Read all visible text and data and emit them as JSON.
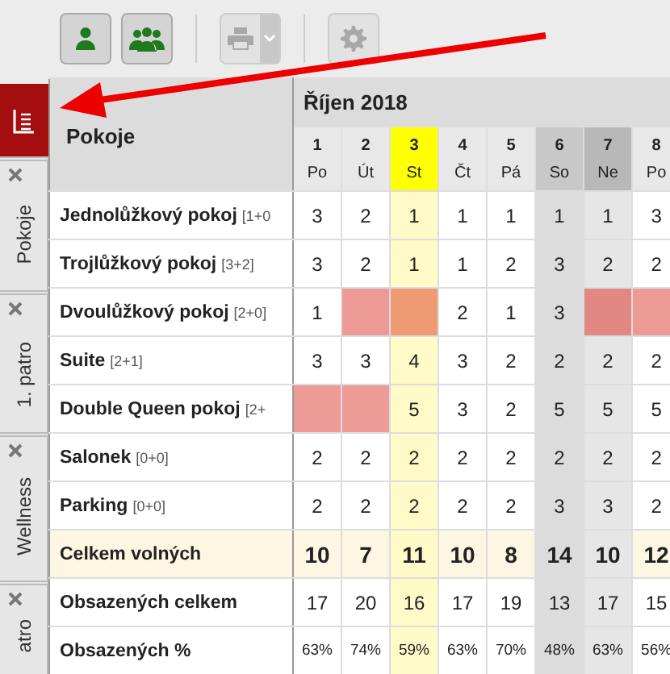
{
  "toolbar": {
    "buttons": [
      {
        "kind": "person",
        "disabled": false
      },
      {
        "kind": "group",
        "disabled": false
      },
      {
        "kind": "print",
        "disabled": true
      },
      {
        "kind": "settings",
        "disabled": true
      }
    ]
  },
  "sidebar": {
    "icon_tab": {
      "selected": true
    },
    "tabs": [
      {
        "label": "Pokoje",
        "closable": true
      },
      {
        "label": "1. patro",
        "closable": true
      },
      {
        "label": "Wellness",
        "closable": true
      },
      {
        "label": "atro",
        "closable": true
      }
    ]
  },
  "table": {
    "corner": "Pokoje",
    "month": "Říjen 2018",
    "days": [
      {
        "num": "1",
        "dow": "Po",
        "kind": "weekday"
      },
      {
        "num": "2",
        "dow": "Út",
        "kind": "weekday"
      },
      {
        "num": "3",
        "dow": "St",
        "kind": "today"
      },
      {
        "num": "4",
        "dow": "Čt",
        "kind": "weekday"
      },
      {
        "num": "5",
        "dow": "Pá",
        "kind": "weekday"
      },
      {
        "num": "6",
        "dow": "So",
        "kind": "saturday"
      },
      {
        "num": "7",
        "dow": "Ne",
        "kind": "sunday"
      },
      {
        "num": "8",
        "dow": "Po",
        "kind": "weekday"
      }
    ],
    "rows": [
      {
        "kind": "room",
        "name": "Jednolůžkový pokoj",
        "capacity": "[1+0",
        "cells": [
          {
            "text": "3",
            "occupied": false
          },
          {
            "text": "2",
            "occupied": false
          },
          {
            "text": "1",
            "occupied": false
          },
          {
            "text": "1",
            "occupied": false
          },
          {
            "text": "1",
            "occupied": false
          },
          {
            "text": "1",
            "occupied": false
          },
          {
            "text": "1",
            "occupied": false
          },
          {
            "text": "3",
            "occupied": false
          }
        ]
      },
      {
        "kind": "room",
        "name": "Trojlůžkový pokoj",
        "capacity": "[3+2]",
        "cells": [
          {
            "text": "3",
            "occupied": false
          },
          {
            "text": "2",
            "occupied": false
          },
          {
            "text": "1",
            "occupied": false
          },
          {
            "text": "1",
            "occupied": false
          },
          {
            "text": "2",
            "occupied": false
          },
          {
            "text": "3",
            "occupied": false
          },
          {
            "text": "2",
            "occupied": false
          },
          {
            "text": "2",
            "occupied": false
          }
        ]
      },
      {
        "kind": "room",
        "name": "Dvoulůžkový pokoj",
        "capacity": "[2+0]",
        "cells": [
          {
            "text": "1",
            "occupied": false
          },
          {
            "occupied": true
          },
          {
            "occupied": true
          },
          {
            "text": "2",
            "occupied": false
          },
          {
            "text": "1",
            "occupied": false
          },
          {
            "text": "3",
            "occupied": false
          },
          {
            "occupied": true
          },
          {
            "occupied": true
          }
        ]
      },
      {
        "kind": "room",
        "name": "Suite",
        "capacity": "[2+1]",
        "cells": [
          {
            "text": "3",
            "occupied": false
          },
          {
            "text": "3",
            "occupied": false
          },
          {
            "text": "4",
            "occupied": false
          },
          {
            "text": "3",
            "occupied": false
          },
          {
            "text": "2",
            "occupied": false
          },
          {
            "text": "2",
            "occupied": false
          },
          {
            "text": "2",
            "occupied": false
          },
          {
            "text": "2",
            "occupied": false
          }
        ]
      },
      {
        "kind": "room",
        "name": "Double Queen pokoj",
        "capacity": "[2+",
        "cells": [
          {
            "occupied": true
          },
          {
            "occupied": true
          },
          {
            "text": "5",
            "occupied": false
          },
          {
            "text": "3",
            "occupied": false
          },
          {
            "text": "2",
            "occupied": false
          },
          {
            "text": "5",
            "occupied": false
          },
          {
            "text": "5",
            "occupied": false
          },
          {
            "text": "5",
            "occupied": false
          }
        ]
      },
      {
        "kind": "room",
        "name": "Salonek",
        "capacity": "[0+0]",
        "cells": [
          {
            "text": "2",
            "occupied": false
          },
          {
            "text": "2",
            "occupied": false
          },
          {
            "text": "2",
            "occupied": false
          },
          {
            "text": "2",
            "occupied": false
          },
          {
            "text": "2",
            "occupied": false
          },
          {
            "text": "2",
            "occupied": false
          },
          {
            "text": "2",
            "occupied": false
          },
          {
            "text": "2",
            "occupied": false
          }
        ]
      },
      {
        "kind": "room",
        "name": "Parking",
        "capacity": "[0+0]",
        "cells": [
          {
            "text": "2",
            "occupied": false
          },
          {
            "text": "2",
            "occupied": false
          },
          {
            "text": "2",
            "occupied": false
          },
          {
            "text": "2",
            "occupied": false
          },
          {
            "text": "2",
            "occupied": false
          },
          {
            "text": "3",
            "occupied": false
          },
          {
            "text": "3",
            "occupied": false
          },
          {
            "text": "2",
            "occupied": false
          }
        ]
      },
      {
        "kind": "total",
        "name": "Celkem volných",
        "cells": [
          {
            "text": "10",
            "occupied": false
          },
          {
            "text": "7",
            "occupied": false
          },
          {
            "text": "11",
            "occupied": false
          },
          {
            "text": "10",
            "occupied": false
          },
          {
            "text": "8",
            "occupied": false
          },
          {
            "text": "14",
            "occupied": false
          },
          {
            "text": "10",
            "occupied": false
          },
          {
            "text": "12",
            "occupied": false
          }
        ]
      },
      {
        "kind": "stat",
        "name": "Obsazených celkem",
        "cells": [
          {
            "text": "17",
            "occupied": false
          },
          {
            "text": "20",
            "occupied": false
          },
          {
            "text": "16",
            "occupied": false
          },
          {
            "text": "17",
            "occupied": false
          },
          {
            "text": "19",
            "occupied": false
          },
          {
            "text": "13",
            "occupied": false
          },
          {
            "text": "17",
            "occupied": false
          },
          {
            "text": "15",
            "occupied": false
          }
        ]
      },
      {
        "kind": "percent",
        "name": "Obsazených %",
        "cells": [
          {
            "text": "63%",
            "occupied": false
          },
          {
            "text": "74%",
            "occupied": false
          },
          {
            "text": "59%",
            "occupied": false
          },
          {
            "text": "63%",
            "occupied": false
          },
          {
            "text": "70%",
            "occupied": false
          },
          {
            "text": "48%",
            "occupied": false
          },
          {
            "text": "63%",
            "occupied": false
          },
          {
            "text": "56%",
            "occupied": false
          }
        ]
      }
    ]
  }
}
